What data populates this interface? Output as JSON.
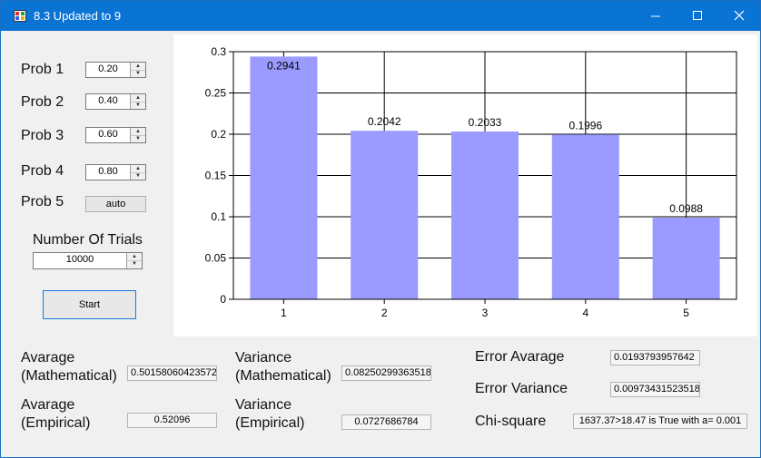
{
  "window": {
    "title": "8.3 Updated to 9"
  },
  "probs": [
    {
      "label": "Prob 1",
      "value": "0.20"
    },
    {
      "label": "Prob 2",
      "value": "0.40"
    },
    {
      "label": "Prob 3",
      "value": "0.60"
    },
    {
      "label": "Prob 4",
      "value": "0.80"
    }
  ],
  "prob5": {
    "label": "Prob 5",
    "button": "auto"
  },
  "trials": {
    "label": "Number Of Trials",
    "value": "10000"
  },
  "start_label": "Start",
  "results": {
    "avg_math_label_1": "Avarage",
    "avg_math_label_2": "(Mathematical)",
    "avg_math_value": "0.50158060423572",
    "avg_emp_label_1": "Avarage",
    "avg_emp_label_2": "(Empirical)",
    "avg_emp_value": "0.52096",
    "var_math_label_1": "Variance",
    "var_math_label_2": "(Mathematical)",
    "var_math_value": "0.08250299363518",
    "var_emp_label_1": "Variance",
    "var_emp_label_2": "(Empirical)",
    "var_emp_value": "0.0727686784",
    "err_avg_label": "Error Avarage",
    "err_avg_value": "0.0193793957642",
    "err_var_label": "Error Variance",
    "err_var_value": "0.00973431523518",
    "chi_label": "Chi-square",
    "chi_value": "1637.37>18.47 is True with a= 0.001"
  },
  "colors": {
    "bar": "#9a9aff",
    "title_bar": "#0a74d4"
  },
  "chart_data": {
    "type": "bar",
    "categories": [
      "1",
      "2",
      "3",
      "4",
      "5"
    ],
    "values": [
      0.2941,
      0.2042,
      0.2033,
      0.1996,
      0.0988
    ],
    "data_labels": [
      "0.2941",
      "0.2042",
      "0.2033",
      "0.1996",
      "0.0988"
    ],
    "y_ticks": [
      "0",
      "0.05",
      "0.1",
      "0.15",
      "0.2",
      "0.25",
      "0.3"
    ],
    "ylim": [
      0,
      0.3
    ],
    "grid": true,
    "title": "",
    "xlabel": "",
    "ylabel": ""
  }
}
